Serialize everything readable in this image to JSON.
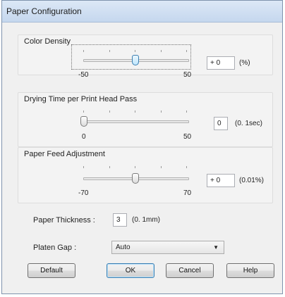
{
  "window": {
    "title": "Paper Configuration"
  },
  "color_density": {
    "label": "Color Density",
    "min_label": "-50",
    "max_label": "50",
    "value": "+ 0",
    "unit": "(%)"
  },
  "drying_time": {
    "label": "Drying Time per Print Head Pass",
    "min_label": "0",
    "max_label": "50",
    "value": "0",
    "unit": "(0. 1sec)"
  },
  "paper_feed": {
    "label": "Paper Feed Adjustment",
    "min_label": "-70",
    "max_label": "70",
    "value": "+ 0",
    "unit": "(0.01%)"
  },
  "paper_thickness": {
    "label": "Paper Thickness :",
    "value": "3",
    "unit": "(0. 1mm)"
  },
  "platen_gap": {
    "label": "Platen Gap :",
    "selected": "Auto"
  },
  "buttons": {
    "default": "Default",
    "ok": "OK",
    "cancel": "Cancel",
    "help": "Help"
  },
  "colors": {
    "title_bar": "#c5d7ee",
    "dialog_bg": "#f0f0f0",
    "accent": "#3c7fb1"
  }
}
